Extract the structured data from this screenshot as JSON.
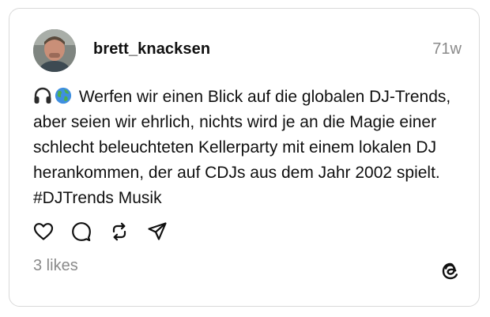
{
  "post": {
    "username": "brett_knacksen",
    "timestamp": "71w",
    "text": "Werfen wir einen Blick auf die globalen DJ-Trends, aber seien wir ehrlich, nichts wird je an die Magie einer schlecht beleuchteten Kellerparty mit einem lokalen DJ herankommen, der auf CDJs aus dem Jahr 2002 spielt. #DJTrends Musik",
    "emojis": [
      "headphones-icon",
      "globe-icon"
    ],
    "likes": "3 likes"
  },
  "actions": [
    "heart-icon",
    "comment-icon",
    "repost-icon",
    "share-icon"
  ],
  "brand": {
    "logo": "threads-logo-icon"
  },
  "colors": {
    "text": "#101010",
    "muted": "#8a8a8a",
    "border": "#d9d9d9"
  }
}
